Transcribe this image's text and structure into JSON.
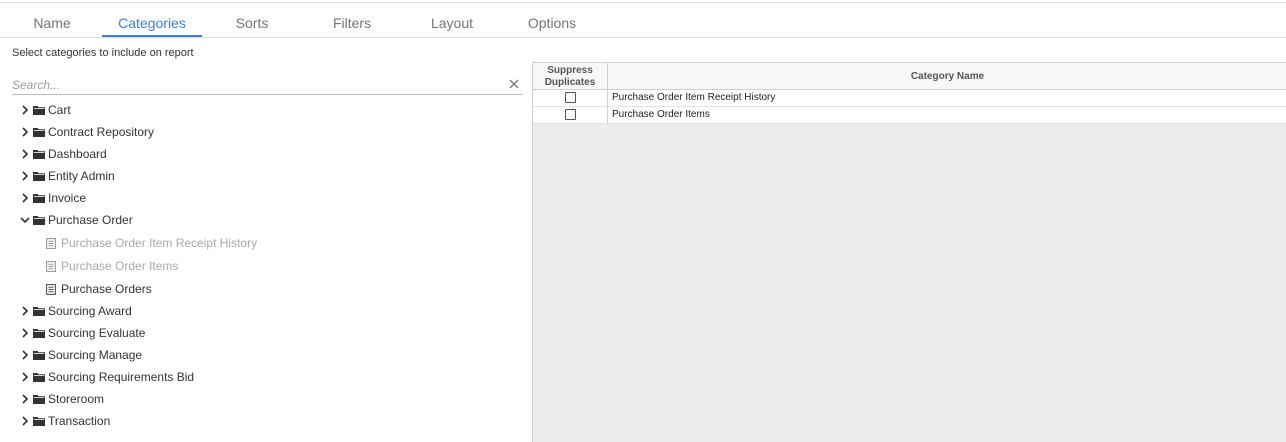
{
  "tabs": [
    {
      "label": "Name",
      "active": false
    },
    {
      "label": "Categories",
      "active": true
    },
    {
      "label": "Sorts",
      "active": false
    },
    {
      "label": "Filters",
      "active": false
    },
    {
      "label": "Layout",
      "active": false
    },
    {
      "label": "Options",
      "active": false
    }
  ],
  "instructions": "Select categories to include on report",
  "search": {
    "placeholder": "Search...",
    "value": ""
  },
  "tree": {
    "folders": [
      {
        "label": "Cart",
        "expanded": false
      },
      {
        "label": "Contract Repository",
        "expanded": false
      },
      {
        "label": "Dashboard",
        "expanded": false
      },
      {
        "label": "Entity Admin",
        "expanded": false
      },
      {
        "label": "Invoice",
        "expanded": false
      },
      {
        "label": "Purchase Order",
        "expanded": true,
        "children": [
          {
            "label": "Purchase Order Item Receipt History",
            "selected": true
          },
          {
            "label": "Purchase Order Items",
            "selected": true
          },
          {
            "label": "Purchase Orders",
            "selected": false
          }
        ]
      },
      {
        "label": "Sourcing Award",
        "expanded": false
      },
      {
        "label": "Sourcing Evaluate",
        "expanded": false
      },
      {
        "label": "Sourcing Manage",
        "expanded": false
      },
      {
        "label": "Sourcing Requirements Bid",
        "expanded": false
      },
      {
        "label": "Storeroom",
        "expanded": false
      },
      {
        "label": "Transaction",
        "expanded": false
      }
    ]
  },
  "grid": {
    "headers": {
      "suppress": "Suppress Duplicates",
      "category": "Category Name"
    },
    "rows": [
      {
        "suppress": false,
        "category": "Purchase Order Item Receipt History"
      },
      {
        "suppress": false,
        "category": "Purchase Order Items"
      }
    ]
  },
  "colors": {
    "accent": "#3f7fd6",
    "disabled_text": "#a9a9a9",
    "grid_bg": "#ececec"
  }
}
